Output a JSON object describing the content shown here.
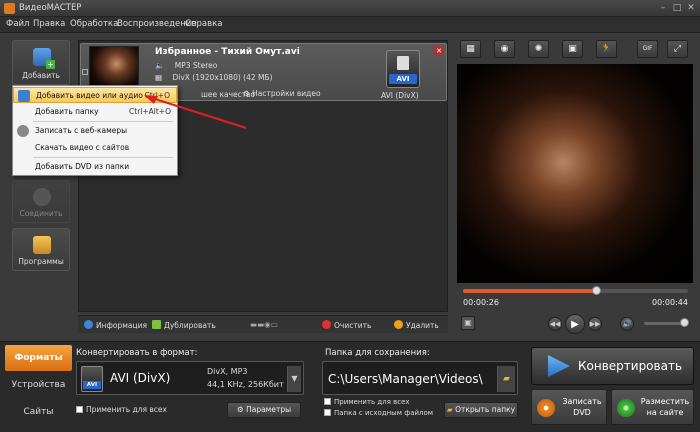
{
  "window": {
    "title": "ВидеоМАСТЕР",
    "minimize": "–",
    "maximize": "□",
    "close": "✕"
  },
  "menu": [
    "Файл",
    "Правка",
    "Обработка",
    "Воспроизведение",
    "Справка"
  ],
  "sidebar": {
    "add_label": "Добавить",
    "join_label": "Соединить",
    "programs_label": "Программы"
  },
  "dropdown": {
    "items": [
      {
        "label": "Добавить видео или аудио",
        "shortcut": "Ctrl+O"
      },
      {
        "label": "Добавить папку",
        "shortcut": "Ctrl+Alt+O"
      },
      {
        "label": "Записать с веб-камеры",
        "shortcut": ""
      },
      {
        "label": "Скачать видео с сайтов",
        "shortcut": ""
      },
      {
        "label": "Добавить DVD из папки",
        "shortcut": ""
      }
    ]
  },
  "file": {
    "name": "Избранное - Тихий Омут.avi",
    "audio": "MP3 Stereo",
    "video": "DivX (1920x1080) (42 МБ)",
    "quality_label": "шее качество",
    "video_settings": "Настройки видео",
    "format_badge": "AVI",
    "format_caption": "AVI (DivX)"
  },
  "list_toolbar": {
    "info": "Информация",
    "duplicate": "Дублировать",
    "clear": "Очистить",
    "delete": "Удалить"
  },
  "preview": {
    "time_current": "00:00:26",
    "time_total": "00:00:44",
    "progress": 0.59,
    "gif_label": "GIF"
  },
  "bottom": {
    "tabs": [
      "Форматы",
      "Устройства",
      "Сайты"
    ],
    "convert_label": "Конвертировать в формат:",
    "format_name": "AVI (DivX)",
    "format_line1": "DivX, MP3",
    "format_line2": "44,1 KHz, 256Кбит",
    "format_badge": "AVI",
    "apply_all": "Применить для всех",
    "params": "Параметры",
    "folder_label": "Папка для сохранения:",
    "folder_path": "C:\\Users\\Manager\\Videos\\",
    "apply_all_folder": "Применить для всех",
    "source_folder": "Папка с исходным файлом",
    "open_folder": "Открыть папку",
    "convert_button": "Конвертировать",
    "burn_dvd": "Записать DVD",
    "publish": "Разместить на сайте"
  },
  "colors": {
    "accent_orange": "#e8861f",
    "avi_blue": "#2767c9",
    "seek_red": "#e35a2a"
  }
}
